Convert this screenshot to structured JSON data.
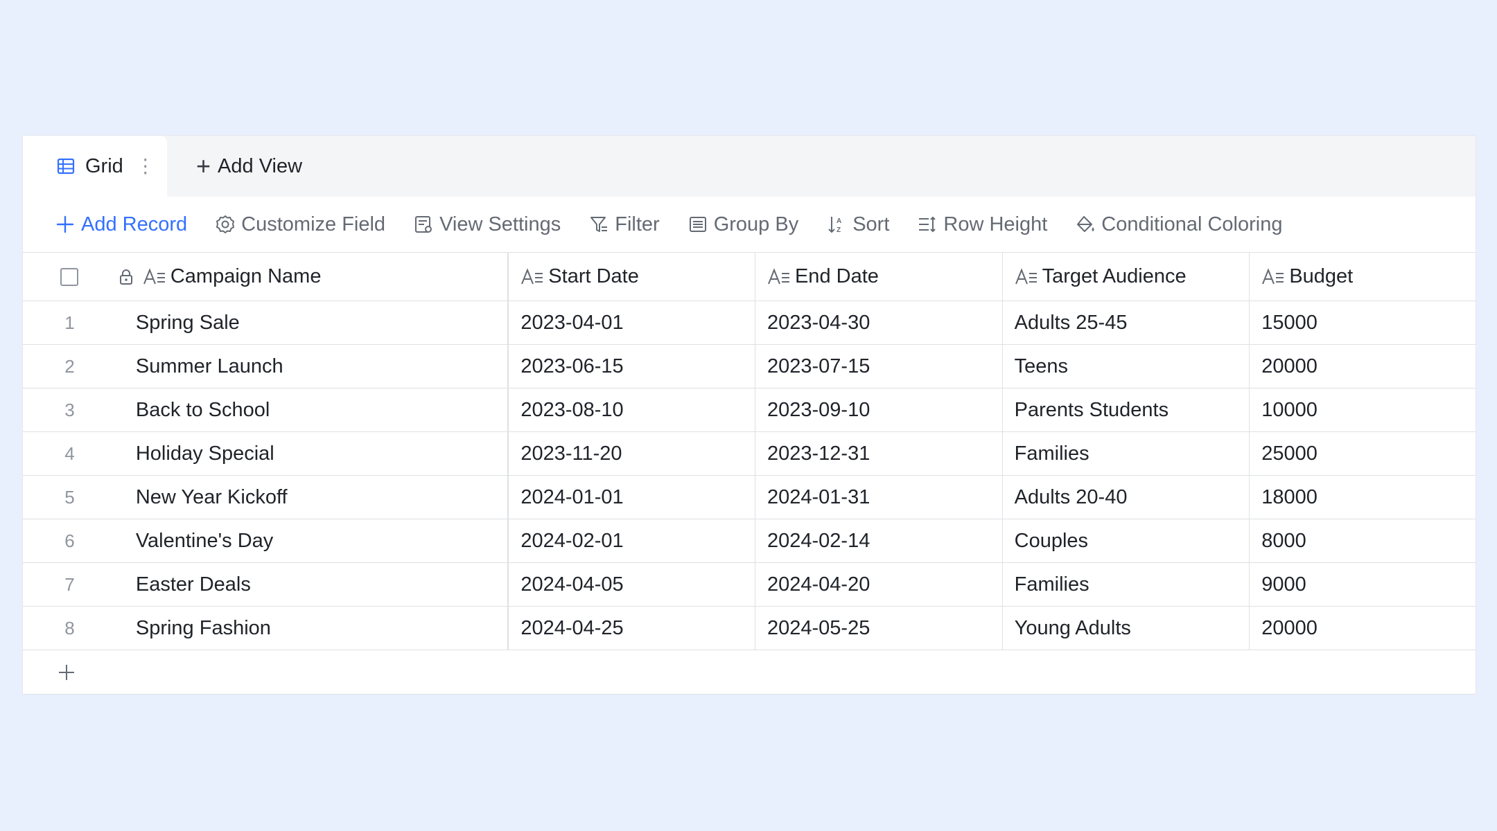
{
  "tabs": {
    "active_label": "Grid",
    "add_view_label": "Add View"
  },
  "toolbar": {
    "add_record": "Add Record",
    "customize_field": "Customize Field",
    "view_settings": "View Settings",
    "filter": "Filter",
    "group_by": "Group By",
    "sort": "Sort",
    "row_height": "Row Height",
    "conditional_coloring": "Conditional Coloring"
  },
  "colors": {
    "accent": "#3370ff",
    "background": "#e8effd"
  },
  "table": {
    "columns": [
      "Campaign Name",
      "Start Date",
      "End Date",
      "Target Audience",
      "Budget"
    ],
    "rows": [
      {
        "index": "1",
        "name": "Spring Sale",
        "start": "2023-04-01",
        "end": "2023-04-30",
        "audience": "Adults 25-45",
        "budget": "15000"
      },
      {
        "index": "2",
        "name": "Summer Launch",
        "start": "2023-06-15",
        "end": "2023-07-15",
        "audience": "Teens",
        "budget": "20000"
      },
      {
        "index": "3",
        "name": "Back to School",
        "start": "2023-08-10",
        "end": "2023-09-10",
        "audience": "Parents Students",
        "budget": "10000"
      },
      {
        "index": "4",
        "name": "Holiday Special",
        "start": "2023-11-20",
        "end": "2023-12-31",
        "audience": "Families",
        "budget": "25000"
      },
      {
        "index": "5",
        "name": "New Year Kickoff",
        "start": "2024-01-01",
        "end": "2024-01-31",
        "audience": "Adults 20-40",
        "budget": "18000"
      },
      {
        "index": "6",
        "name": "Valentine's Day",
        "start": "2024-02-01",
        "end": "2024-02-14",
        "audience": "Couples",
        "budget": "8000"
      },
      {
        "index": "7",
        "name": "Easter Deals",
        "start": "2024-04-05",
        "end": "2024-04-20",
        "audience": "Families",
        "budget": "9000"
      },
      {
        "index": "8",
        "name": "Spring Fashion",
        "start": "2024-04-25",
        "end": "2024-05-25",
        "audience": "Young Adults",
        "budget": "20000"
      }
    ]
  }
}
